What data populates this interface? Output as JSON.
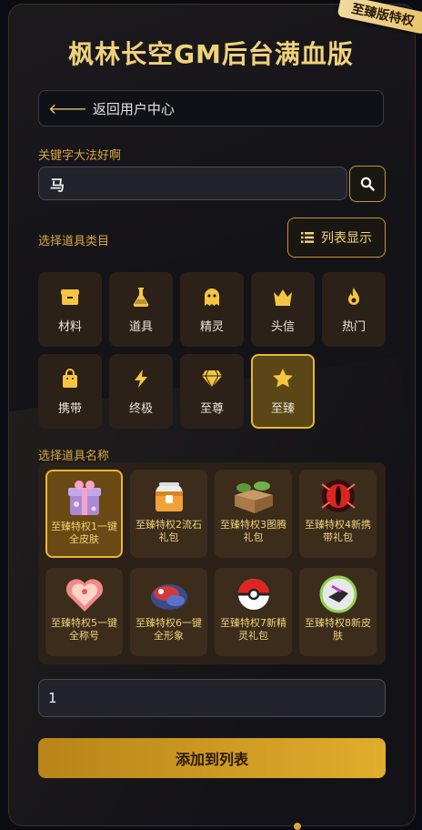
{
  "ribbon": "至臻版特权",
  "title": "枫林长空GM后台满血版",
  "back_label": "返回用户中心",
  "keyword_label": "关键字大法好啊",
  "search": {
    "value": "马"
  },
  "category_label": "选择道具类目",
  "list_view_label": "列表显示",
  "categories": [
    {
      "label": "材料",
      "icon": "box-icon"
    },
    {
      "label": "道具",
      "icon": "flask-icon"
    },
    {
      "label": "精灵",
      "icon": "ghost-icon"
    },
    {
      "label": "头信",
      "icon": "crown-icon"
    },
    {
      "label": "热门",
      "icon": "fire-icon"
    },
    {
      "label": "携带",
      "icon": "bag-icon"
    },
    {
      "label": "终极",
      "icon": "bolt-icon"
    },
    {
      "label": "至尊",
      "icon": "gem-icon"
    },
    {
      "label": "至臻",
      "icon": "star-icon",
      "active": true
    }
  ],
  "item_label": "选择道具名称",
  "items": [
    {
      "name": "至臻特权1一键全皮肤",
      "active": true
    },
    {
      "name": "至臻特权2流石礼包"
    },
    {
      "name": "至臻特权3图腾礼包"
    },
    {
      "name": "至臻特权4新携带礼包"
    },
    {
      "name": "至臻特权5一键全称号"
    },
    {
      "name": "至臻特权6一键全形象"
    },
    {
      "name": "至臻特权7新精灵礼包"
    },
    {
      "name": "至臻特权8新皮肤"
    }
  ],
  "quantity": {
    "value": "1"
  },
  "add_label": "添加到列表",
  "colors": {
    "accent": "#f0d279",
    "gold": "#e8b636",
    "tile": "#2b2118"
  }
}
